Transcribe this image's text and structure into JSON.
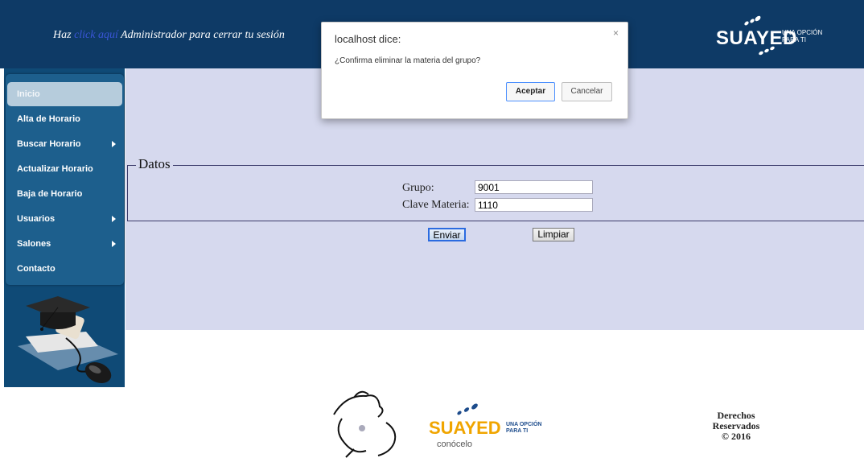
{
  "header": {
    "msg_before": "Haz",
    "link_text": "click aquí",
    "msg_after": "Administrador para cerrar tu sesión",
    "brand_word": "SUAYED",
    "brand_tag_1": "UNA OPCIÓN",
    "brand_tag_2": "PARA TI"
  },
  "menu": {
    "items": [
      {
        "label": "Inicio",
        "active": true,
        "submenu": false
      },
      {
        "label": "Alta de Horario",
        "submenu": false
      },
      {
        "label": "Buscar Horario",
        "submenu": true
      },
      {
        "label": "Actualizar Horario",
        "submenu": false
      },
      {
        "label": "Baja de Horario",
        "submenu": false
      },
      {
        "label": "Usuarios",
        "submenu": true
      },
      {
        "label": "Salones",
        "submenu": true
      },
      {
        "label": "Contacto",
        "submenu": false
      }
    ]
  },
  "form": {
    "legend": "Datos",
    "grupo_label": "Grupo:",
    "grupo_value": "9001",
    "clave_label": "Clave Materia:",
    "clave_value": "1110",
    "send_label": "Enviar",
    "clear_label": "Limpiar"
  },
  "dialog": {
    "title": "localhost dice:",
    "message": "¿Confirma eliminar la materia del grupo?",
    "ok_label": "Aceptar",
    "cancel_label": "Cancelar",
    "close_glyph": "×"
  },
  "footer": {
    "logo_word": "SUAYED",
    "logo_tag_1": "UNA OPCIÓN",
    "logo_tag_2": "PARA TI",
    "logo_sub": "conócelo",
    "copyright_1": "Derechos",
    "copyright_2": "Reservados",
    "copyright_3": "© 2016"
  },
  "colors": {
    "header_bg": "#0e3a66",
    "content_bg": "#d6d9ee",
    "menu_bg": "#1d5f8d",
    "accent_orange": "#f0a500"
  }
}
